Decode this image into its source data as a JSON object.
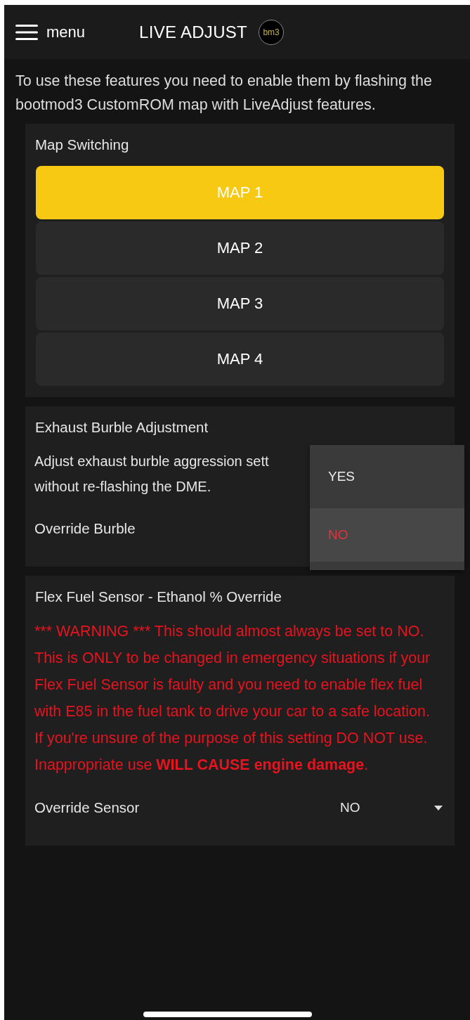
{
  "header": {
    "menu_label": "menu",
    "title": "LIVE ADJUST",
    "logo_text": "bm3"
  },
  "intro": "To use these features you need to enable them by flashing the bootmod3 CustomROM map with LiveAdjust features.",
  "map_switching": {
    "title": "Map Switching",
    "maps": [
      {
        "label": "MAP 1",
        "selected": true
      },
      {
        "label": "MAP 2",
        "selected": false
      },
      {
        "label": "MAP 3",
        "selected": false
      },
      {
        "label": "MAP 4",
        "selected": false
      }
    ]
  },
  "burble": {
    "title": "Exhaust Burble Adjustment",
    "description": "Adjust exhaust burble aggression sett\nwithout re-flashing the DME.",
    "setting_label": "Override Burble",
    "dropdown_options": [
      {
        "label": "YES",
        "selected": false
      },
      {
        "label": "NO",
        "selected": true
      }
    ]
  },
  "flex_fuel": {
    "title": "Flex Fuel Sensor - Ethanol % Override",
    "warning_prefix": "*** WARNING ***",
    "warning": "This should almost always be set to NO. This is ONLY to be changed in emergency situations if your Flex Fuel Sensor is faulty and you need to enable flex fuel with E85 in the fuel tank to drive your car to a safe location. If you're unsure of the purpose of this setting DO NOT use. Inappropriate use **WILL CAUSE engine damage**.",
    "setting_label": "Override Sensor",
    "setting_value": "NO"
  }
}
